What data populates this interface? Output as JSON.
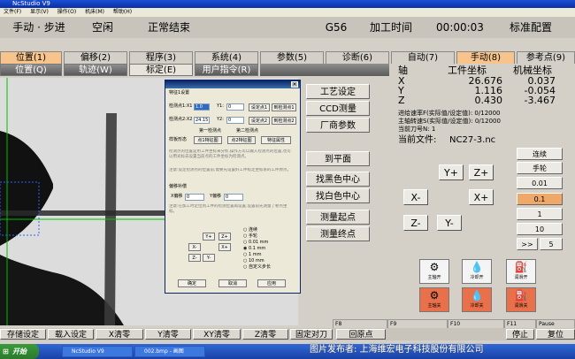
{
  "window": {
    "title": "NcStudio V9"
  },
  "menu": [
    "文件(F)",
    "显示(V)",
    "操作(O)",
    "机床(M)",
    "帮助(H)"
  ],
  "status": {
    "mode": "手动 · 步进",
    "state": "空闲",
    "result": "正常结束",
    "gcode": "G56",
    "time_label": "加工时间",
    "time_value": "00:00:03",
    "config": "标准配置"
  },
  "tabs_main": [
    {
      "label": "位置(1)",
      "active": true
    },
    {
      "label": "偏移(2)",
      "active": false
    },
    {
      "label": "程序(3)",
      "active": false
    },
    {
      "label": "系统(4)",
      "active": false
    },
    {
      "label": "参数(5)",
      "active": false
    },
    {
      "label": "诊断(6)",
      "active": false
    },
    {
      "label": "自动(7)",
      "active": false
    },
    {
      "label": "手动(8)",
      "active": true
    },
    {
      "label": "参考点(9)",
      "active": false
    }
  ],
  "tabs_sub": [
    {
      "label": "位置(Q)",
      "style": "dark"
    },
    {
      "label": "轨迹(W)",
      "style": "dark"
    },
    {
      "label": "标定(E)",
      "style": "light"
    },
    {
      "label": "用户指令(R)",
      "style": "dark"
    }
  ],
  "dialog": {
    "section1": "特征1设置",
    "pt1_label": "检测点1:X1",
    "pt1_x": "1.0",
    "pt1_y_label": "Y1:",
    "pt1_y": "0",
    "pt2_label": "检测点2:X2",
    "pt2_x": "24.15",
    "pt2_y_label": "Y2:",
    "pt2_y": "0",
    "set_pt1": "设定点1",
    "go_pt1": "到检测点1",
    "set_pt2": "设定点2",
    "go_pt2": "到检测点2",
    "group1": "第一检测点",
    "group2": "第二检测点",
    "feature_label": "样板形态",
    "feat_btn1": "点1特征图",
    "feat_btn2": "点2特征图",
    "feat_btn3": "特征属性",
    "hint1": "检测点的位置是用工件坐标来分析,操作方可以输入检测点的位置,也可以用光标去设置当前点的工件坐标为检测点。",
    "hint2": "注意:设定检测点的位置前,需要先设置好工件标定坐标系的工件原点。",
    "section2": "偏移补偿",
    "xoff_label": "X偏移",
    "xoff": "0",
    "yoff_label": "Y偏移",
    "yoff": "0",
    "hint3": "注意:在加工时定位到工件的检测位置再设置,设置前先测量了靶点坐标。",
    "jog_labels": [
      "Y+",
      "Z+",
      "X-",
      "X+",
      "Z-",
      "Y-"
    ],
    "radios": [
      "连续",
      "手轮",
      "0.01 mm",
      "0.1 mm",
      "1 mm",
      "10 mm",
      "自定义步长"
    ],
    "ok": "确定",
    "cancel": "取消",
    "apply": "应用"
  },
  "func_buttons": [
    "工艺设定",
    "CCD测量",
    "厂商参数",
    "到平面",
    "找黑色中心",
    "找白色中心",
    "测量起点",
    "测量终点"
  ],
  "coords": {
    "head_axis": "轴",
    "head_work": "工件坐标",
    "head_mach": "机械坐标",
    "rows": [
      {
        "axis": "X",
        "work": "26.676",
        "mach": "0.037"
      },
      {
        "axis": "Y",
        "work": "1.116",
        "mach": "-0.054"
      },
      {
        "axis": "Z",
        "work": "0.430",
        "mach": "-3.467"
      }
    ]
  },
  "info": {
    "feed": "进给速率F(实际值/设定值): 0/12000",
    "spindle": "主轴转速S(实际值/设定值): 0/12000",
    "tool": "当前刀号N: 1",
    "file_label": "当前文件:",
    "file_name": "NC27-3.nc"
  },
  "jog": [
    "Y+",
    "Z+",
    "X-",
    "X+",
    "Z-",
    "Y-"
  ],
  "speed": {
    "continuous": "连续",
    "handwheel": "手轮",
    "steps": [
      "0.01",
      "0.1",
      "1",
      "10"
    ],
    "selected": "0.1",
    "more": ">>",
    "more_value": "5"
  },
  "machine_buttons": [
    {
      "label": "主轴开",
      "active": false
    },
    {
      "label": "冷却开",
      "active": false
    },
    {
      "label": "润滑开",
      "active": false
    },
    {
      "label": "主轴关",
      "active": true
    },
    {
      "label": "冷却关",
      "active": true
    },
    {
      "label": "润滑关",
      "active": true
    }
  ],
  "bottom_buttons": [
    "存储设定",
    "载入设定",
    "X清零",
    "Y清零",
    "XY清零",
    "Z清零",
    "固定对刀",
    "回原点",
    "停止",
    "复位"
  ],
  "fkeys": [
    "F8",
    "F9",
    "F10",
    "F11",
    "Pause"
  ],
  "taskbar": {
    "start": "开始",
    "tasks": [
      "NcStudio V9",
      "002.bmp - 画图"
    ],
    "watermark": "图片发布者: 上海维宏电子科技股份有限公司"
  },
  "colors": {
    "accent": "#f7c48b",
    "active_button": "#e8704a",
    "highlight": "#f0a868"
  }
}
